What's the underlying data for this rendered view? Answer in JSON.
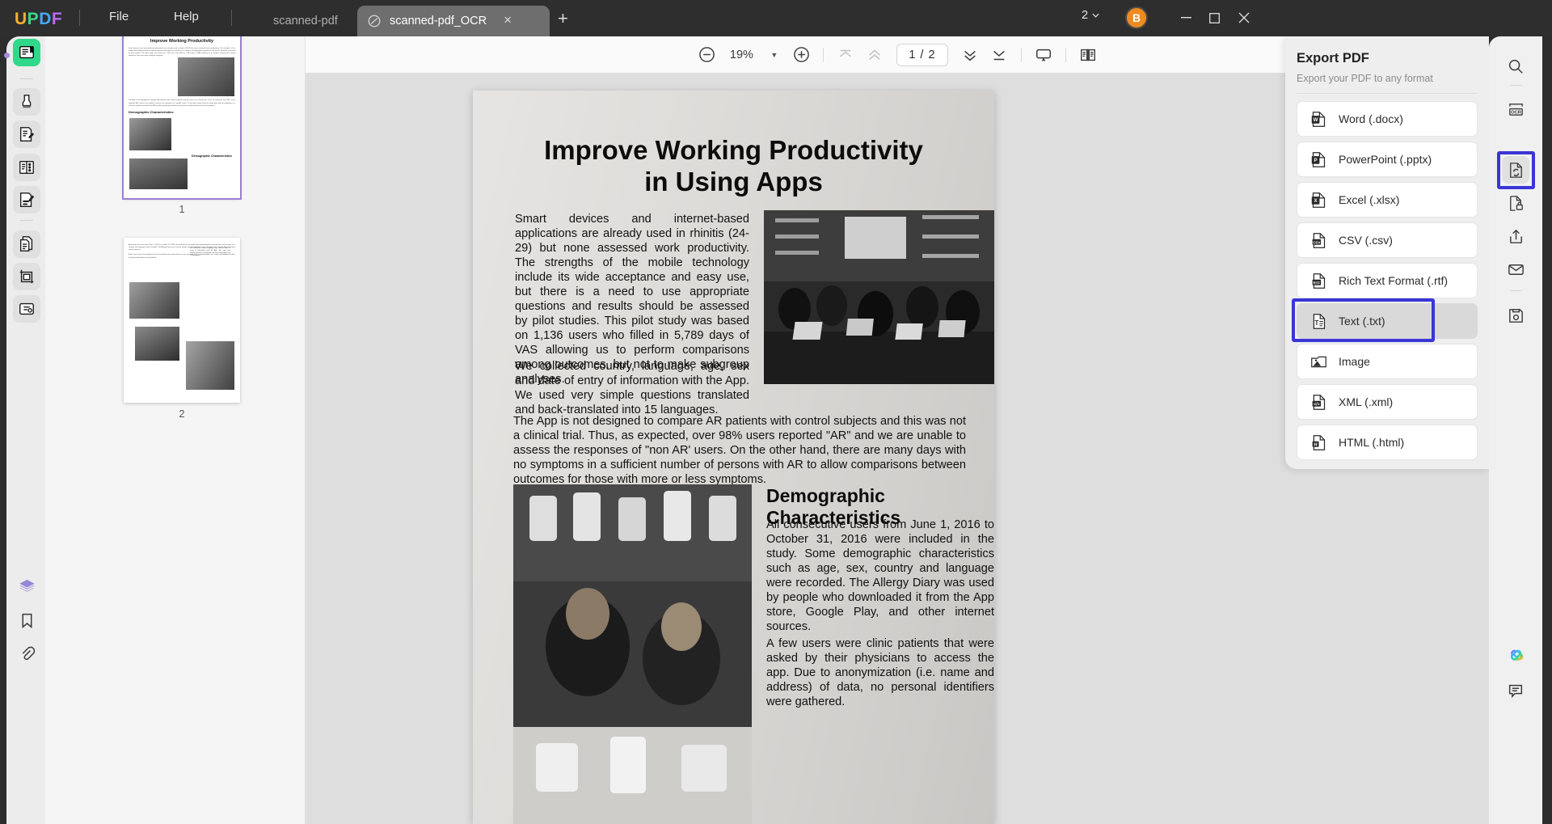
{
  "app": {
    "logo_letters": [
      "U",
      "P",
      "D",
      "F"
    ],
    "logo_colors": [
      "#f5b12e",
      "#3fd38a",
      "#47a7f5",
      "#b96cf0"
    ],
    "menus": [
      {
        "label": "File",
        "name": "menu-file"
      },
      {
        "label": "Help",
        "name": "menu-help"
      }
    ],
    "tabs": [
      {
        "label": "scanned-pdf",
        "active": false
      },
      {
        "label": "scanned-pdf_OCR",
        "active": true,
        "close_glyph": "×"
      }
    ],
    "new_tab_glyph": "+",
    "page_count_badge": "2",
    "avatar_initial": "B",
    "window_controls": {
      "minimize": "–",
      "maximize": "❐",
      "close": "✕"
    }
  },
  "left_sidebar": {
    "items": [
      {
        "name": "sidebar-item-reader",
        "icon": "reader-book-icon",
        "active": true
      },
      {
        "name": "sidebar-item-markup",
        "icon": "highlighter-marker-icon",
        "active": false
      },
      {
        "name": "sidebar-item-edit-pdf",
        "icon": "edit-document-pen-icon",
        "active": false
      },
      {
        "name": "sidebar-item-organize",
        "icon": "page-list-icon",
        "active": false
      },
      {
        "name": "sidebar-item-annotate",
        "icon": "annotate-pen-icon",
        "active": false
      },
      {
        "name": "sidebar-item-convert",
        "icon": "convert-pages-icon",
        "active": false
      },
      {
        "name": "sidebar-item-crop",
        "icon": "crop-page-icon",
        "active": false
      },
      {
        "name": "sidebar-item-protect",
        "icon": "stamp-shield-icon",
        "active": false
      }
    ],
    "bottom_items": [
      {
        "name": "sidebar-item-layers",
        "icon": "layers-icon"
      },
      {
        "name": "sidebar-item-bookmark",
        "icon": "bookmark-icon"
      },
      {
        "name": "sidebar-item-attachment",
        "icon": "paperclip-icon"
      }
    ]
  },
  "thumbnails": [
    {
      "label": "1",
      "selected": true
    },
    {
      "label": "2",
      "selected": false
    }
  ],
  "toolbar": {
    "zoom_out_label": "zoom-out",
    "zoom_value": "19%",
    "zoom_in_label": "zoom-in",
    "page_indicator": "1 / 2",
    "buttons": [
      {
        "name": "first-page-button",
        "icon": "chevron-up-bar-icon",
        "dim": true
      },
      {
        "name": "previous-page-button",
        "icon": "chevron-up-double-icon",
        "dim": true
      },
      {
        "name": "next-page-button",
        "icon": "chevron-down-double-icon",
        "dim": false
      },
      {
        "name": "last-page-button",
        "icon": "chevron-down-bar-icon",
        "dim": false
      },
      {
        "name": "presentation-mode-button",
        "icon": "presentation-screen-icon",
        "dim": false
      },
      {
        "name": "page-layout-button",
        "icon": "two-page-view-icon",
        "dim": false
      }
    ]
  },
  "document": {
    "title": "Improve Working Productivity in Using Apps",
    "title_line1": "Improve Working Productivity",
    "title_line2": "in Using Apps",
    "paragraph_1": "Smart devices and internet-based applications are already used in rhinitis (24-29) but none assessed work productivity. The strengths of the mobile technology include its wide acceptance and easy use, but there is a need to use appropriate questions and results should be assessed by pilot studies. This pilot study was based on 1,136 users who filled in 5,789 days of VAS allowing us to perform comparisons among outcomes, but not to make subgroup analyses.",
    "paragraph_2": "We collected country, language, age, sex and date of entry of information with the App. We used very simple questions translated and back-translated into 15 languages.",
    "paragraph_3": "The App is not designed to compare AR patients with control subjects and this was not a clinical trial. Thus, as expected, over 98% users reported \"AR\" and we are unable to assess the responses of \"non AR' users. On the other hand, there are many days with no symptoms in a sufficient number of persons with AR to allow comparisons between outcomes for those with more or less symptoms.",
    "section_heading": "Demographic Characteristics",
    "paragraph_4": "All consecutive users from June 1, 2016 to October 31, 2016 were included in the study. Some demographic characteristics such as age, sex, country and language were recorded. The Allergy Diary was used by people who downloaded it from the App store, Google Play, and other internet sources.",
    "paragraph_5": "A few users were clinic patients that were asked by their physicians to access the app. Due to anonymization (i.e. name and address) of data, no personal identifiers were gathered."
  },
  "export_panel": {
    "title": "Export PDF",
    "subtitle": "Export your PDF to any format",
    "highlight_color": "#3b35d6",
    "items": [
      {
        "label": "Word (.docx)",
        "icon": "word-file-icon",
        "badge": "W",
        "badge_color": "#2b579a",
        "state": "normal"
      },
      {
        "label": "PowerPoint (.pptx)",
        "icon": "powerpoint-file-icon",
        "badge": "P",
        "badge_color": "#d24726",
        "state": "normal"
      },
      {
        "label": "Excel (.xlsx)",
        "icon": "excel-file-icon",
        "badge": "X",
        "badge_color": "#217346",
        "state": "normal"
      },
      {
        "label": "CSV (.csv)",
        "icon": "csv-file-icon",
        "badge": "CSV",
        "badge_color": "#2f2f2f",
        "state": "normal"
      },
      {
        "label": "Rich Text Format (.rtf)",
        "icon": "rtf-file-icon",
        "badge": "RTF",
        "badge_color": "#2f2f2f",
        "state": "normal"
      },
      {
        "label": "Text (.txt)",
        "icon": "text-file-icon",
        "badge": "T",
        "badge_color": "#2f2f2f",
        "state": "highlighted"
      },
      {
        "label": "Image",
        "icon": "image-file-icon",
        "badge": "",
        "badge_color": "#2f2f2f",
        "state": "normal"
      },
      {
        "label": "XML (.xml)",
        "icon": "xml-file-icon",
        "badge": "</>",
        "badge_color": "#2f2f2f",
        "state": "normal"
      },
      {
        "label": "HTML (.html)",
        "icon": "html-file-icon",
        "badge": "H",
        "badge_color": "#2f2f2f",
        "state": "normal"
      }
    ]
  },
  "right_sidebar": {
    "highlight_color": "#3b35d6",
    "items": [
      {
        "name": "search-icon",
        "label": "Search",
        "active": false
      },
      {
        "name": "ocr-icon",
        "label": "OCR",
        "active": false
      },
      {
        "name": "convert-export-icon",
        "label": "Export PDF",
        "active": true
      },
      {
        "name": "protect-lock-icon",
        "label": "Protect",
        "active": false
      },
      {
        "name": "share-upload-icon",
        "label": "Share",
        "active": false
      },
      {
        "name": "email-envelope-icon",
        "label": "Email",
        "active": false
      },
      {
        "name": "save-disk-icon",
        "label": "Save",
        "active": false
      }
    ],
    "bottom_items": [
      {
        "name": "ai-assistant-icon",
        "label": "AI Assistant"
      },
      {
        "name": "comment-chat-icon",
        "label": "Comment"
      }
    ]
  }
}
